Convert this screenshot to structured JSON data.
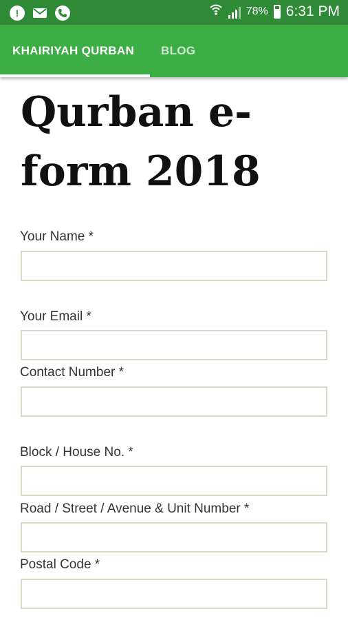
{
  "status_bar": {
    "left_icons": [
      "alert-icon",
      "mail-icon",
      "phone-icon"
    ],
    "battery_percent": "78%",
    "time": "6:31 PM"
  },
  "app_bar": {
    "tabs": [
      {
        "label": "KHAIRIYAH QURBAN",
        "active": true
      },
      {
        "label": "BLOG",
        "active": false
      }
    ],
    "color": "#3dae46"
  },
  "page": {
    "title_line1": "Qurban e-",
    "title_line2": "form 2018"
  },
  "form": {
    "fields": [
      {
        "label": "Your Name *",
        "value": ""
      },
      {
        "label": "Your Email *",
        "value": ""
      },
      {
        "label": "Contact Number *",
        "value": ""
      },
      {
        "label": "Block / House No. *",
        "value": ""
      },
      {
        "label": "Road / Street / Avenue & Unit Number *",
        "value": ""
      },
      {
        "label": "Postal Code *",
        "value": ""
      }
    ]
  }
}
